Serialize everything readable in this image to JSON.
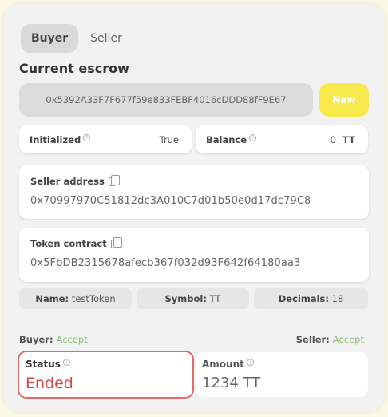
{
  "tabs": [
    {
      "label": "Buyer",
      "active": true
    },
    {
      "label": "Seller",
      "active": false
    }
  ],
  "escrow": {
    "title": "Current escrow",
    "address_value": "0x5392A33F7F677f59e833FEBF4016cDDD88fF9E67",
    "new_button_label": "New"
  },
  "initialized": {
    "label": "Initialized",
    "value": "True"
  },
  "balance": {
    "label": "Balance",
    "value": "0",
    "unit": "TT"
  },
  "seller_address": {
    "label": "Seller address",
    "value": "0x70997970C51812dc3A010C7d01b50e0d17dc79C8"
  },
  "token_contract": {
    "label": "Token contract",
    "value": "0x5FbDB2315678afecb367f032d93F642f64180aa3"
  },
  "token": {
    "name_label": "Name:",
    "name_value": "testToken",
    "symbol_label": "Symbol:",
    "symbol_value": "TT",
    "decimals_label": "Decimals:",
    "decimals_value": "18"
  },
  "parties": {
    "buyer_label": "Buyer:",
    "buyer_state": "Accept",
    "seller_label": "Seller:",
    "seller_state": "Accept"
  },
  "status": {
    "label": "Status",
    "value": "Ended"
  },
  "amount": {
    "label": "Amount",
    "value": "1234 TT"
  },
  "colors": {
    "background": "#fbf8e3",
    "new_button": "#f7e94b",
    "accept_green": "#8dc07a",
    "status_red": "#d94444",
    "status_border": "#e26a6a"
  },
  "icons": {
    "info": "info-circle-icon",
    "copy": "copy-icon"
  }
}
